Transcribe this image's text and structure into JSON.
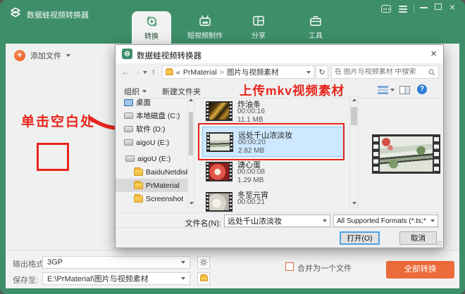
{
  "colors": {
    "header_green": "#3e8e6a",
    "accent_orange": "#ed6a3a",
    "annotation_red": "#e8241d",
    "selection_blue": "#cde8ff",
    "help_blue": "#2f7fd6"
  },
  "app": {
    "title": "数据蛙视频转换器",
    "tabs": [
      {
        "label": "转换",
        "active": true
      },
      {
        "label": "短视频制作",
        "active": false
      },
      {
        "label": "分享",
        "active": false
      },
      {
        "label": "工具",
        "active": false
      }
    ],
    "add_file_label": "添加文件",
    "annotation_click_blank": "单击空白处",
    "output_format_label": "输出格式:",
    "output_format_value": "3GP",
    "save_to_label": "保存至:",
    "save_to_value": "E:\\PrMaterial\\图片与视频素材",
    "merge_label": "合并为一个文件",
    "convert_all_label": "全部转换"
  },
  "dialog": {
    "title": "数据蛙视频转换器",
    "close_glyph": "×",
    "nav": {
      "back": "←",
      "forward": "→",
      "up": "↑",
      "refresh": "↻"
    },
    "breadcrumb": {
      "collapse": "«",
      "part1": "PrMaterial",
      "sep": ">",
      "part2": "图片与视频素材"
    },
    "search_placeholder": "在 图片与视频素材 中搜索",
    "toolbar": {
      "organize": "组织",
      "new_folder": "新建文件夹",
      "help_glyph": "?"
    },
    "annotation_upload": "上传mkv视频素材",
    "sidebar": [
      {
        "label": "桌面"
      },
      {
        "label": "本地磁盘 (C:)"
      },
      {
        "label": "软件 (D:)"
      },
      {
        "label": "aigoU (E:)"
      },
      {
        "label": "aigoU (E:)"
      },
      {
        "label": "BaiduNetdisk"
      },
      {
        "label": "PrMaterial"
      },
      {
        "label": "Screenshot"
      }
    ],
    "files": [
      {
        "name": "炸油条",
        "duration": "00:00:16",
        "size": "11.1 MB"
      },
      {
        "name": "远处千山浓淡妆",
        "duration": "00:00:20",
        "size": "2.82 MB"
      },
      {
        "name": "溏心蛋",
        "duration": "00:00:08",
        "size": "1.29 MB"
      },
      {
        "name": "冬至元宵",
        "duration": "00:00:21",
        "size": ""
      }
    ],
    "filename_label": "文件名(N):",
    "filename_value": "远处千山浓淡妆",
    "format_filter": "All Supported Formats (*.ts;*",
    "open_label": "打开(O)",
    "cancel_label": "取消"
  }
}
